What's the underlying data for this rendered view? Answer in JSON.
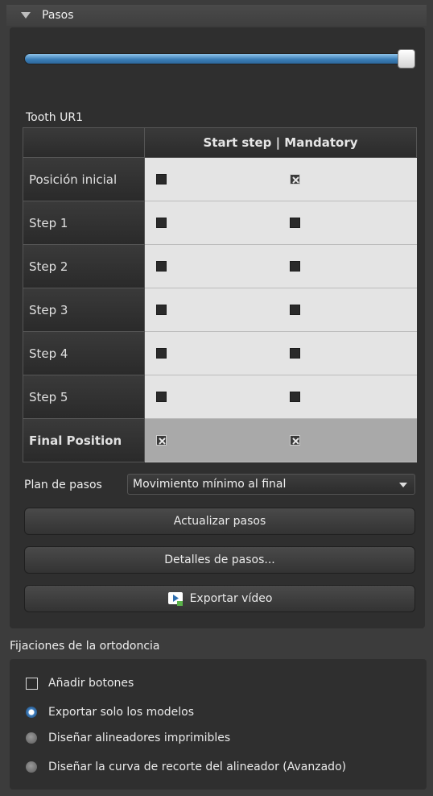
{
  "section": {
    "title": "Pasos"
  },
  "tooth": {
    "label": "Tooth UR1"
  },
  "grid": {
    "column_header": "Start step | Mandatory",
    "rows": [
      {
        "label": "Posición inicial",
        "start_step": false,
        "mandatory": true
      },
      {
        "label": "Step 1",
        "start_step": false,
        "mandatory": false
      },
      {
        "label": "Step 2",
        "start_step": false,
        "mandatory": false
      },
      {
        "label": "Step 3",
        "start_step": false,
        "mandatory": false
      },
      {
        "label": "Step 4",
        "start_step": false,
        "mandatory": false
      },
      {
        "label": "Step 5",
        "start_step": false,
        "mandatory": false
      },
      {
        "label": "Final Position",
        "start_step": true,
        "mandatory": true
      }
    ]
  },
  "plan": {
    "label": "Plan de pasos",
    "value": "Movimiento mínimo al final"
  },
  "buttons": {
    "update": "Actualizar pasos",
    "details": "Detalles de pasos...",
    "export_video": "Exportar vídeo"
  },
  "fijaciones": {
    "title": "Fijaciones de la ortodoncia",
    "add_buttons": "Añadir botones",
    "options": [
      "Exportar solo los modelos",
      "Diseñar alineadores imprimibles",
      "Diseñar la curva de recorte del alineador (Avanzado)"
    ]
  },
  "colors": {
    "accent": "#3b7fb8"
  }
}
